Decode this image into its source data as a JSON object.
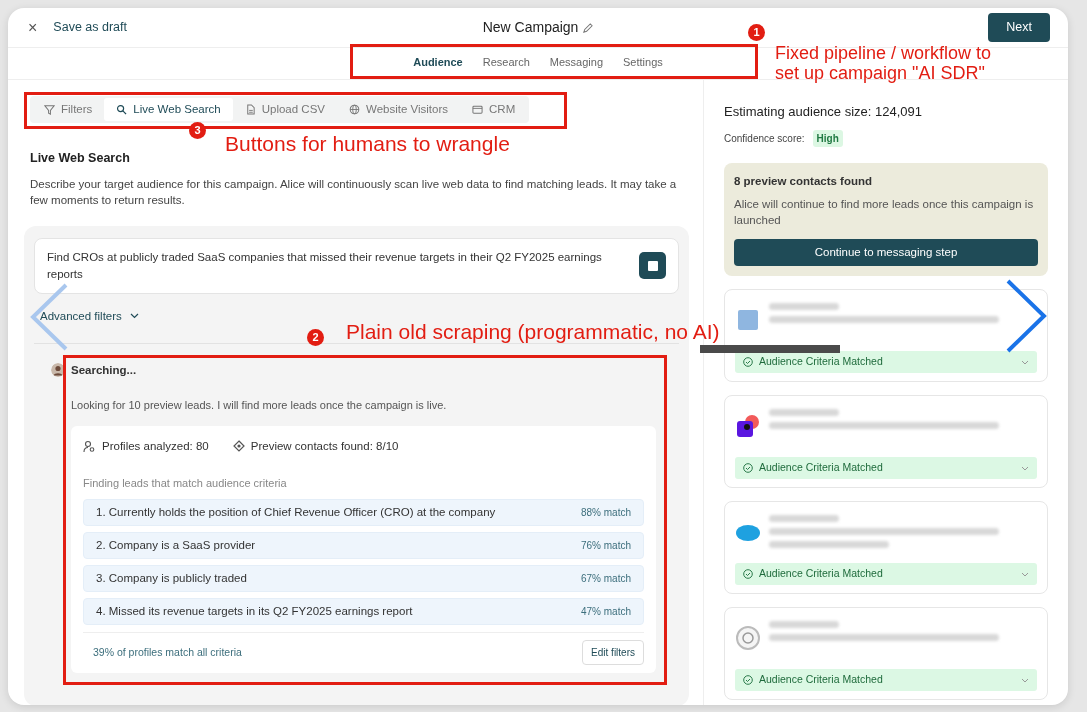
{
  "header": {
    "close": "×",
    "save": "Save as draft",
    "title": "New Campaign",
    "next": "Next"
  },
  "tabs": [
    {
      "label": "Audience",
      "selected": true
    },
    {
      "label": "Research",
      "selected": false
    },
    {
      "label": "Messaging",
      "selected": false
    },
    {
      "label": "Settings",
      "selected": false
    }
  ],
  "sources": [
    {
      "label": "Filters",
      "selected": false
    },
    {
      "label": "Live Web Search",
      "selected": true
    },
    {
      "label": "Upload CSV",
      "selected": false
    },
    {
      "label": "Website Visitors",
      "selected": false
    },
    {
      "label": "CRM",
      "selected": false
    }
  ],
  "section": {
    "title": "Live Web Search",
    "description": "Describe your target audience for this campaign. Alice will continuously scan live web data to find matching leads. It may take a few moments to return results."
  },
  "prompt": {
    "value": "Find CROs at publicly traded SaaS companies that missed their revenue targets in their Q2 FY2025 earnings reports"
  },
  "advanced_filters": "Advanced filters",
  "search": {
    "status": "Searching...",
    "message": "Looking for 10 preview leads. I will find more leads once the campaign is live.",
    "profiles": "Profiles analyzed: 80",
    "contacts": "Preview contacts found: 8/10",
    "criteria_title": "Finding leads that match audience criteria",
    "criteria": [
      {
        "text": "1. Currently holds the position of Chief Revenue Officer (CRO) at the company",
        "match": "88% match"
      },
      {
        "text": "2. Company is a SaaS provider",
        "match": "76% match"
      },
      {
        "text": "3. Company is publicly traded",
        "match": "67% match"
      },
      {
        "text": "4. Missed its revenue targets in its Q2 FY2025 earnings report",
        "match": "47% match"
      }
    ],
    "summary": "39% of profiles match all criteria",
    "edit": "Edit filters"
  },
  "estimate": {
    "size": "Estimating audience size: 124,091",
    "confidence_label": "Confidence score:",
    "confidence": "High"
  },
  "preview": {
    "title": "8 preview contacts found",
    "text": "Alice will continue to find more leads once this campaign is launched",
    "button": "Continue to messaging step"
  },
  "leads": [
    {
      "kind": "tile",
      "status": "Audience Criteria Matched"
    },
    {
      "kind": "squares",
      "status": "Audience Criteria Matched"
    },
    {
      "kind": "cloud",
      "status": "Audience Criteria Matched"
    },
    {
      "kind": "ring",
      "status": "Audience Criteria Matched"
    }
  ],
  "annotations": [
    {
      "number": "1",
      "text": "Fixed pipeline / workflow to set up campaign \"AI SDR\""
    },
    {
      "number": "2",
      "text": "Plain old scraping (programmatic, no AI)"
    },
    {
      "number": "3",
      "text": "Buttons for humans to wrangle"
    }
  ]
}
